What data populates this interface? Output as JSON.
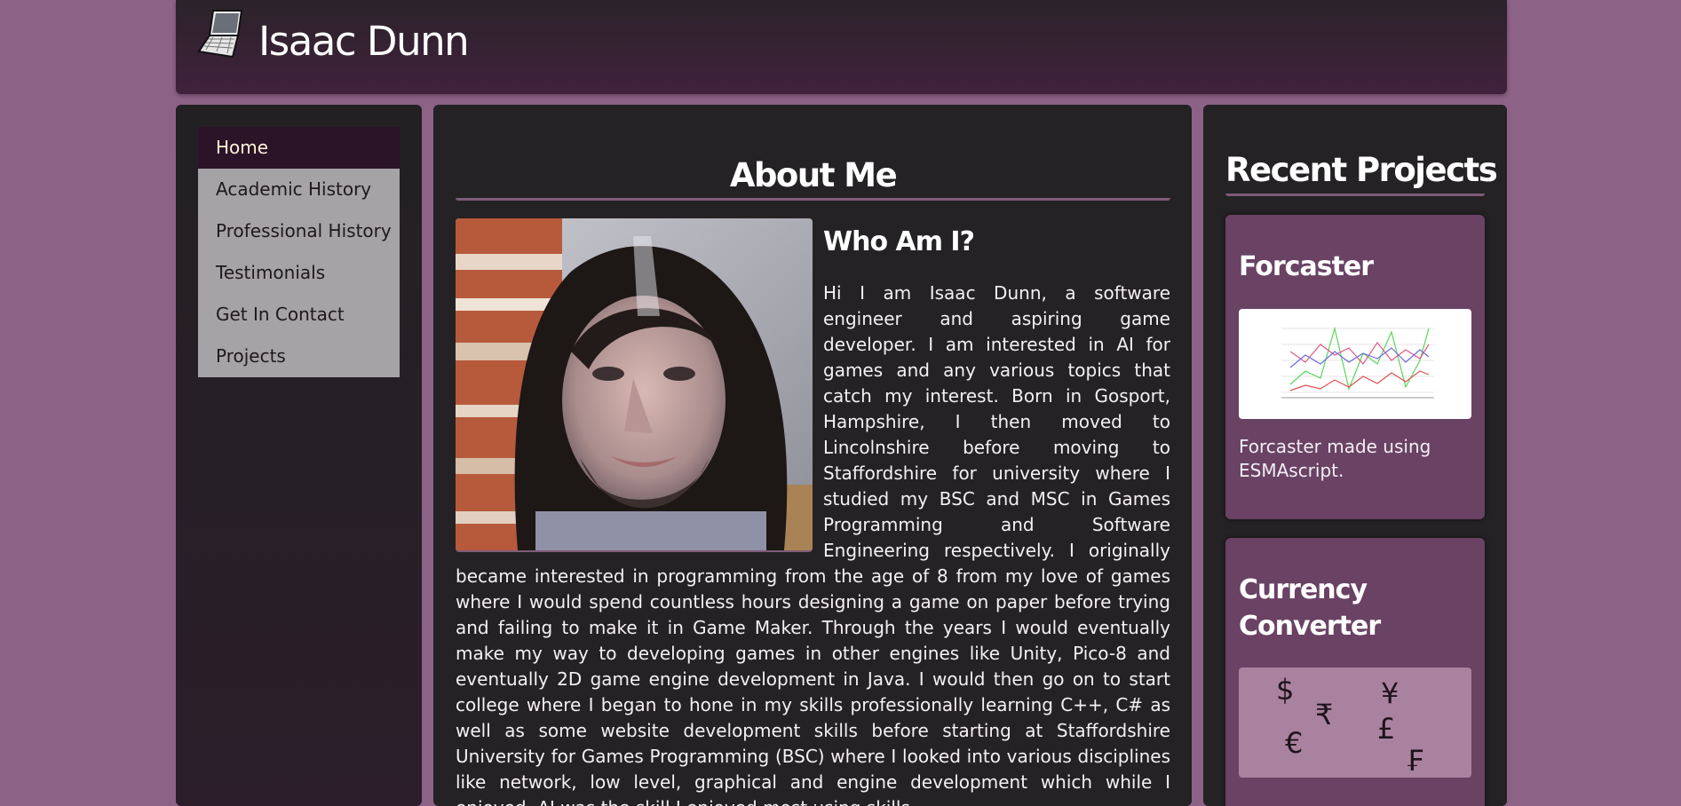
{
  "header": {
    "logo_icon": "laptop-icon",
    "title": "Isaac Dunn"
  },
  "nav": {
    "items": [
      {
        "label": "Home",
        "active": true
      },
      {
        "label": "Academic History"
      },
      {
        "label": "Professional History"
      },
      {
        "label": "Testimonials"
      },
      {
        "label": "Get In Contact"
      },
      {
        "label": "Projects"
      }
    ]
  },
  "main": {
    "heading": "About Me",
    "subheading": "Who Am I?",
    "bio": "Hi I am Isaac Dunn, a software engineer and aspiring game developer. I am interested in AI for games and any various topics that catch my interest. Born in Gosport, Hampshire, I then moved to Lincolnshire before moving to Staffordshire for university where I studied my BSC and MSC in Games Programming and Software Engineering respectively. I originally became interested in programming from the age of 8 from my love of games where I would spend countless hours designing a game on paper before trying and failing to make it in Game Maker. Through the years I would eventually make my way to developing games in other engines like Unity, Pico-8 and eventually 2D game engine development in Java. I would then go on to start college where I began to hone in my skills professionally learning C++, C# as well as some website development skills before starting at Staffordshire University for Games Programming (BSC) where I looked into various disciplines like network, low level, graphical and engine development which while I enjoyed, AI was the skill I enjoyed most using skills"
  },
  "sidebar": {
    "heading": "Recent Projects",
    "projects": [
      {
        "title": "Forcaster",
        "description": "Forcaster made using ESMAscript."
      },
      {
        "title": "Currency Converter",
        "symbols": [
          "$",
          "¥",
          "₹",
          "£",
          "€",
          "₣"
        ]
      }
    ]
  },
  "colors": {
    "page_background": "#8c6287",
    "panel": "#242224",
    "nav_active": "#2b1328",
    "nav_item": "#a6a3a6",
    "project_card": "#694264",
    "accent_rule": "#7e5b78"
  }
}
